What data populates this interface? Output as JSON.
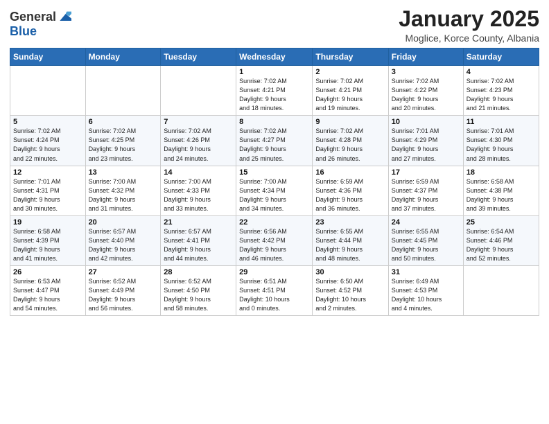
{
  "header": {
    "logo_general": "General",
    "logo_blue": "Blue",
    "month_title": "January 2025",
    "location": "Moglice, Korce County, Albania"
  },
  "weekdays": [
    "Sunday",
    "Monday",
    "Tuesday",
    "Wednesday",
    "Thursday",
    "Friday",
    "Saturday"
  ],
  "weeks": [
    [
      {
        "day": "",
        "info": ""
      },
      {
        "day": "",
        "info": ""
      },
      {
        "day": "",
        "info": ""
      },
      {
        "day": "1",
        "info": "Sunrise: 7:02 AM\nSunset: 4:21 PM\nDaylight: 9 hours\nand 18 minutes."
      },
      {
        "day": "2",
        "info": "Sunrise: 7:02 AM\nSunset: 4:21 PM\nDaylight: 9 hours\nand 19 minutes."
      },
      {
        "day": "3",
        "info": "Sunrise: 7:02 AM\nSunset: 4:22 PM\nDaylight: 9 hours\nand 20 minutes."
      },
      {
        "day": "4",
        "info": "Sunrise: 7:02 AM\nSunset: 4:23 PM\nDaylight: 9 hours\nand 21 minutes."
      }
    ],
    [
      {
        "day": "5",
        "info": "Sunrise: 7:02 AM\nSunset: 4:24 PM\nDaylight: 9 hours\nand 22 minutes."
      },
      {
        "day": "6",
        "info": "Sunrise: 7:02 AM\nSunset: 4:25 PM\nDaylight: 9 hours\nand 23 minutes."
      },
      {
        "day": "7",
        "info": "Sunrise: 7:02 AM\nSunset: 4:26 PM\nDaylight: 9 hours\nand 24 minutes."
      },
      {
        "day": "8",
        "info": "Sunrise: 7:02 AM\nSunset: 4:27 PM\nDaylight: 9 hours\nand 25 minutes."
      },
      {
        "day": "9",
        "info": "Sunrise: 7:02 AM\nSunset: 4:28 PM\nDaylight: 9 hours\nand 26 minutes."
      },
      {
        "day": "10",
        "info": "Sunrise: 7:01 AM\nSunset: 4:29 PM\nDaylight: 9 hours\nand 27 minutes."
      },
      {
        "day": "11",
        "info": "Sunrise: 7:01 AM\nSunset: 4:30 PM\nDaylight: 9 hours\nand 28 minutes."
      }
    ],
    [
      {
        "day": "12",
        "info": "Sunrise: 7:01 AM\nSunset: 4:31 PM\nDaylight: 9 hours\nand 30 minutes."
      },
      {
        "day": "13",
        "info": "Sunrise: 7:00 AM\nSunset: 4:32 PM\nDaylight: 9 hours\nand 31 minutes."
      },
      {
        "day": "14",
        "info": "Sunrise: 7:00 AM\nSunset: 4:33 PM\nDaylight: 9 hours\nand 33 minutes."
      },
      {
        "day": "15",
        "info": "Sunrise: 7:00 AM\nSunset: 4:34 PM\nDaylight: 9 hours\nand 34 minutes."
      },
      {
        "day": "16",
        "info": "Sunrise: 6:59 AM\nSunset: 4:36 PM\nDaylight: 9 hours\nand 36 minutes."
      },
      {
        "day": "17",
        "info": "Sunrise: 6:59 AM\nSunset: 4:37 PM\nDaylight: 9 hours\nand 37 minutes."
      },
      {
        "day": "18",
        "info": "Sunrise: 6:58 AM\nSunset: 4:38 PM\nDaylight: 9 hours\nand 39 minutes."
      }
    ],
    [
      {
        "day": "19",
        "info": "Sunrise: 6:58 AM\nSunset: 4:39 PM\nDaylight: 9 hours\nand 41 minutes."
      },
      {
        "day": "20",
        "info": "Sunrise: 6:57 AM\nSunset: 4:40 PM\nDaylight: 9 hours\nand 42 minutes."
      },
      {
        "day": "21",
        "info": "Sunrise: 6:57 AM\nSunset: 4:41 PM\nDaylight: 9 hours\nand 44 minutes."
      },
      {
        "day": "22",
        "info": "Sunrise: 6:56 AM\nSunset: 4:42 PM\nDaylight: 9 hours\nand 46 minutes."
      },
      {
        "day": "23",
        "info": "Sunrise: 6:55 AM\nSunset: 4:44 PM\nDaylight: 9 hours\nand 48 minutes."
      },
      {
        "day": "24",
        "info": "Sunrise: 6:55 AM\nSunset: 4:45 PM\nDaylight: 9 hours\nand 50 minutes."
      },
      {
        "day": "25",
        "info": "Sunrise: 6:54 AM\nSunset: 4:46 PM\nDaylight: 9 hours\nand 52 minutes."
      }
    ],
    [
      {
        "day": "26",
        "info": "Sunrise: 6:53 AM\nSunset: 4:47 PM\nDaylight: 9 hours\nand 54 minutes."
      },
      {
        "day": "27",
        "info": "Sunrise: 6:52 AM\nSunset: 4:49 PM\nDaylight: 9 hours\nand 56 minutes."
      },
      {
        "day": "28",
        "info": "Sunrise: 6:52 AM\nSunset: 4:50 PM\nDaylight: 9 hours\nand 58 minutes."
      },
      {
        "day": "29",
        "info": "Sunrise: 6:51 AM\nSunset: 4:51 PM\nDaylight: 10 hours\nand 0 minutes."
      },
      {
        "day": "30",
        "info": "Sunrise: 6:50 AM\nSunset: 4:52 PM\nDaylight: 10 hours\nand 2 minutes."
      },
      {
        "day": "31",
        "info": "Sunrise: 6:49 AM\nSunset: 4:53 PM\nDaylight: 10 hours\nand 4 minutes."
      },
      {
        "day": "",
        "info": ""
      }
    ]
  ]
}
